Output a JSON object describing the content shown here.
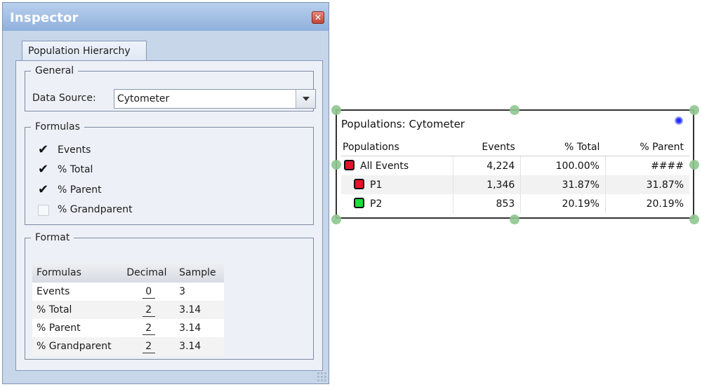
{
  "inspector": {
    "title": "Inspector",
    "close_icon": "close-icon",
    "tab_label": "Population Hierarchy",
    "general": {
      "legend": "General",
      "data_source_label": "Data Source:",
      "data_source_value": "Cytometer"
    },
    "formulas": {
      "legend": "Formulas",
      "items": [
        {
          "label": "Events",
          "checked": true
        },
        {
          "label": "% Total",
          "checked": true
        },
        {
          "label": "% Parent",
          "checked": true
        },
        {
          "label": "% Grandparent",
          "checked": false
        }
      ]
    },
    "format": {
      "legend": "Format",
      "headers": [
        "Formulas",
        "Decimal",
        "Sample"
      ],
      "rows": [
        {
          "formula": "Events",
          "decimal": "0",
          "sample": "3"
        },
        {
          "formula": "% Total",
          "decimal": "2",
          "sample": "3.14"
        },
        {
          "formula": "% Parent",
          "decimal": "2",
          "sample": "3.14"
        },
        {
          "formula": "% Grandparent",
          "decimal": "2",
          "sample": "3.14"
        }
      ]
    }
  },
  "populations": {
    "title": "Populations: Cytometer",
    "headers": [
      "Populations",
      "Events",
      "% Total",
      "% Parent"
    ],
    "rows": [
      {
        "name": "All Events",
        "color": "#e0142a",
        "events": "4,224",
        "total": "100.00%",
        "parent": "####"
      },
      {
        "name": "P1",
        "color": "#e0142a",
        "events": "1,346",
        "total": "31.87%",
        "parent": "31.87%"
      },
      {
        "name": "P2",
        "color": "#18e03c",
        "events": "853",
        "total": "20.19%",
        "parent": "20.19%"
      }
    ]
  }
}
